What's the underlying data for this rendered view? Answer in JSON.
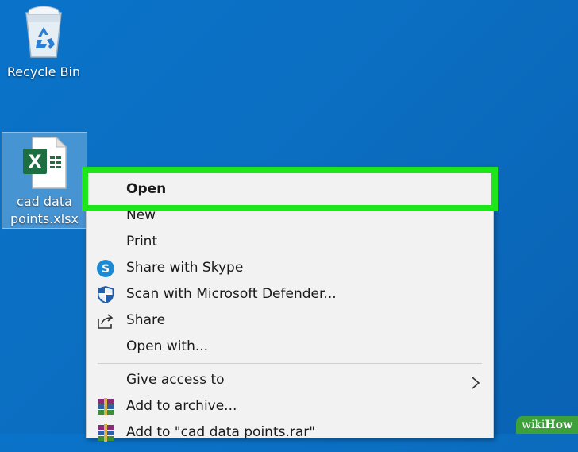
{
  "desktop": {
    "icons": [
      {
        "name": "recycle-bin",
        "label": "Recycle Bin"
      },
      {
        "name": "excel-file",
        "label": "cad data points.xlsx"
      }
    ]
  },
  "context_menu": {
    "items": [
      {
        "label": "Open",
        "bold": true,
        "highlighted": true,
        "icon": null
      },
      {
        "label": "New",
        "icon": null
      },
      {
        "label": "Print",
        "icon": null
      },
      {
        "label": "Share with Skype",
        "icon": "skype-icon"
      },
      {
        "label": "Scan with Microsoft Defender...",
        "icon": "defender-shield-icon"
      },
      {
        "label": "Share",
        "icon": "share-icon"
      },
      {
        "label": "Open with...",
        "icon": null
      },
      {
        "label": "Give access to",
        "icon": null,
        "submenu": true
      },
      {
        "label": "Add to archive...",
        "icon": "winrar-icon"
      },
      {
        "label": "Add to \"cad data points.rar\"",
        "icon": "winrar-icon"
      }
    ]
  },
  "highlight_color": "#1ee61b",
  "watermark": {
    "prefix": "wiki",
    "suffix": "How"
  }
}
